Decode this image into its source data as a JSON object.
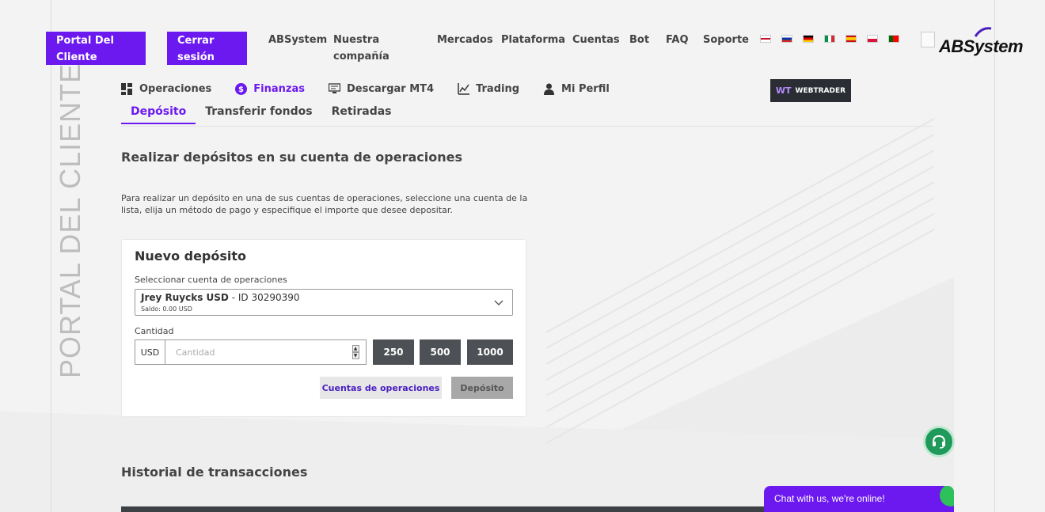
{
  "header": {
    "portal_btn": "Portal Del Cliente",
    "logout_btn": "Cerrar sesión",
    "nav": [
      "ABSystem",
      "Nuestra compañía",
      "Mercados",
      "Plataforma",
      "Cuentas",
      "Bot",
      "FAQ",
      "Soporte"
    ],
    "logo": "ABSystem"
  },
  "side_title": "PORTAL DEL CLIENTE",
  "menu": {
    "items": [
      {
        "label": "Operaciones",
        "icon": "grid-icon"
      },
      {
        "label": "Finanzas",
        "icon": "dollar-icon"
      },
      {
        "label": "Descargar MT4",
        "icon": "monitor-icon"
      },
      {
        "label": "Trading",
        "icon": "chart-icon"
      },
      {
        "label": "Mi Perfil",
        "icon": "user-icon"
      }
    ],
    "webtrader": "WEBTRADER",
    "webtrader_mark": "WT"
  },
  "subtabs": [
    "Depósito",
    "Transferir fondos",
    "Retiradas"
  ],
  "page": {
    "title": "Realizar depósitos en su cuenta de operaciones",
    "description": "Para realizar un depósito en una de sus cuentas de operaciones, seleccione una cuenta de la lista, elija un método de pago y especifique el importe que desee depositar."
  },
  "deposit_form": {
    "title": "Nuevo depósito",
    "account_label": "Seleccionar cuenta de operaciones",
    "account_name": "Jrey Ruycks USD",
    "account_id": " - ID 30290390",
    "account_balance": "Saldo: 0.00 USD",
    "amount_label": "Cantidad",
    "currency": "USD",
    "amount_value": "",
    "amount_placeholder": "Cantidad",
    "quick_amounts": [
      "250",
      "500",
      "1000"
    ],
    "accounts_btn": "Cuentas de operaciones",
    "deposit_btn": "Depósito"
  },
  "history": {
    "title": "Historial de transacciones"
  },
  "chat": {
    "label": "Chat with us, we're online!"
  },
  "colors": {
    "accent": "#6c19f0",
    "dark_button": "#4d5055",
    "support": "#1f9a5a"
  }
}
